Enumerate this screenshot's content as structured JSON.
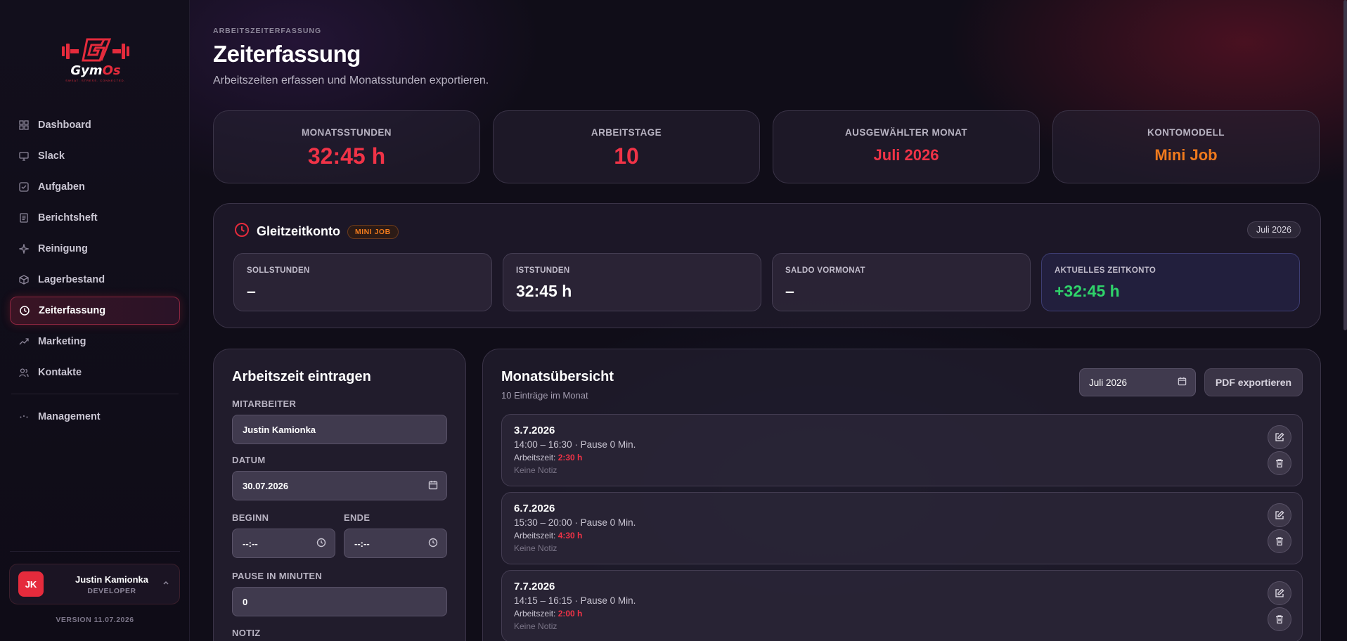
{
  "brand": {
    "name_main": "Gym",
    "name_accent": "Os",
    "tagline": "SWEAT. STRESS. CONNECTED."
  },
  "nav": {
    "items": [
      {
        "label": "Dashboard",
        "icon": "grid-icon"
      },
      {
        "label": "Slack",
        "icon": "monitor-icon"
      },
      {
        "label": "Aufgaben",
        "icon": "checkbox-icon"
      },
      {
        "label": "Berichtsheft",
        "icon": "document-icon"
      },
      {
        "label": "Reinigung",
        "icon": "sparkle-icon"
      },
      {
        "label": "Lagerbestand",
        "icon": "box-icon"
      },
      {
        "label": "Zeiterfassung",
        "icon": "clock-icon",
        "active": true
      },
      {
        "label": "Marketing",
        "icon": "trending-up-icon"
      },
      {
        "label": "Kontakte",
        "icon": "users-icon"
      }
    ],
    "management": "Management"
  },
  "user": {
    "initials": "JK",
    "name": "Justin Kamionka",
    "role": "DEVELOPER"
  },
  "version": "VERSION 11.07.2026",
  "header": {
    "eyebrow": "ARBEITSZEITERFASSUNG",
    "title": "Zeiterfassung",
    "subtitle": "Arbeitszeiten erfassen und Monatsstunden exportieren."
  },
  "stats": [
    {
      "label": "MONATSSTUNDEN",
      "value": "32:45 h"
    },
    {
      "label": "ARBEITSTAGE",
      "value": "10"
    },
    {
      "label": "AUSGEWÄHLTER MONAT",
      "value": "Juli 2026"
    },
    {
      "label": "KONTOMODELL",
      "value": "Mini Job"
    }
  ],
  "gleitzeit": {
    "title": "Gleitzeitkonto",
    "badge": "MINI JOB",
    "month": "Juli 2026",
    "cards": [
      {
        "label": "SOLLSTUNDEN",
        "value": "–"
      },
      {
        "label": "ISTSTUNDEN",
        "value": "32:45 h"
      },
      {
        "label": "SALDO VORMONAT",
        "value": "–"
      },
      {
        "label": "AKTUELLES ZEITKONTO",
        "value": "+32:45 h"
      }
    ]
  },
  "form": {
    "title": "Arbeitszeit eintragen",
    "employee_label": "MITARBEITER",
    "employee_value": "Justin Kamionka",
    "date_label": "DATUM",
    "date_value": "30.07.2026",
    "start_label": "BEGINN",
    "start_value": "--:--",
    "end_label": "ENDE",
    "end_value": "--:--",
    "pause_label": "PAUSE IN MINUTEN",
    "pause_value": "0",
    "note_label": "NOTIZ"
  },
  "overview": {
    "title": "Monatsübersicht",
    "subtitle": "10 Einträge im Monat",
    "month_value": "Juli 2026",
    "export_label": "PDF exportieren",
    "worktime_prefix": "Arbeitszeit:",
    "entries": [
      {
        "date": "3.7.2026",
        "time": "14:00 – 16:30 · Pause 0 Min.",
        "duration": "2:30 h",
        "note": "Keine Notiz"
      },
      {
        "date": "6.7.2026",
        "time": "15:30 – 20:00 · Pause 0 Min.",
        "duration": "4:30 h",
        "note": "Keine Notiz"
      },
      {
        "date": "7.7.2026",
        "time": "14:15 – 16:15 · Pause 0 Min.",
        "duration": "2:00 h",
        "note": "Keine Notiz"
      }
    ]
  },
  "colors": {
    "accent": "#e52b3c",
    "orange": "#f07a1d",
    "green": "#2fd36a"
  }
}
